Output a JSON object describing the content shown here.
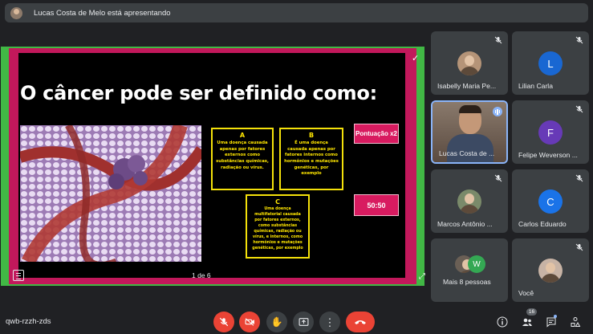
{
  "presentation_bar": {
    "text": "Lucas Costa de Melo está apresentando"
  },
  "slide": {
    "title": "O câncer pode ser definido como:",
    "options": [
      {
        "letter": "A",
        "text": "Uma doença causada apenas por fatores externos como substâncias químicas, radiação ou vírus."
      },
      {
        "letter": "B",
        "text": "É uma doença causada apenas por fatores internos como hormônios e mutações genéticas, por exemplo"
      },
      {
        "letter": "C",
        "text": "Uma doença multifatorial causada por fatores externos, como substâncias químicas, radiação ou vírus, e internos, como hormônios e mutações genéticas, por exemplo"
      }
    ],
    "powerups": {
      "double": "Pontuação x2",
      "fifty": "50:50"
    },
    "page": "1 de 6"
  },
  "participants": [
    {
      "name": "Isabelly Maria Pe...",
      "type": "photo"
    },
    {
      "name": "Lilian Carla",
      "initial": "L",
      "color": "#1967d2"
    },
    {
      "name": "Lucas Costa de ...",
      "type": "video"
    },
    {
      "name": "Felipe Weverson ...",
      "initial": "F",
      "color": "#673ab7"
    },
    {
      "name": "Marcos Antônio ...",
      "type": "photo"
    },
    {
      "name": "Carlos Eduardo",
      "initial": "C",
      "color": "#1a73e8"
    },
    {
      "name": "Mais 8 pessoas",
      "initial": "W",
      "color": "#34a853"
    },
    {
      "name": "Você",
      "type": "photo"
    }
  ],
  "bottom": {
    "meeting_code": "qwb-rzzh-zds",
    "participant_count": "16"
  },
  "colors": {
    "accent": "#8ab4f8",
    "danger": "#ea4335",
    "surface": "#3c4043",
    "slide_frame": "#c2185b",
    "option_border": "#f4e10a"
  }
}
